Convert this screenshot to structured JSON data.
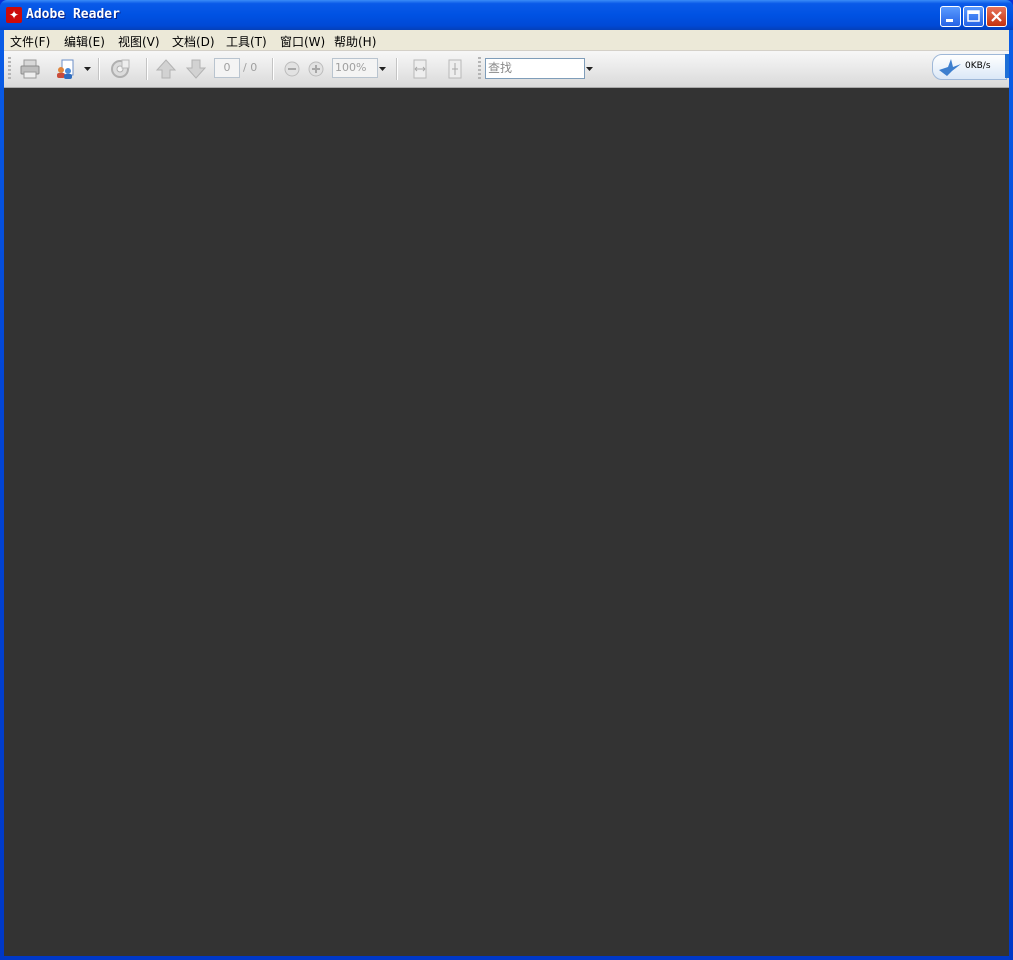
{
  "window": {
    "title": "Adobe Reader",
    "app_icon": "adobe-pdf-icon"
  },
  "caption_buttons": {
    "minimize": "minimize-icon",
    "maximize": "maximize-icon",
    "close": "close-icon"
  },
  "menu": {
    "items": [
      {
        "label": "文件(F)"
      },
      {
        "label": "编辑(E)"
      },
      {
        "label": "视图(V)"
      },
      {
        "label": "文档(D)"
      },
      {
        "label": "工具(T)"
      },
      {
        "label": "窗口(W)"
      },
      {
        "label": "帮助(H)"
      }
    ]
  },
  "toolbar": {
    "page_current": "0",
    "page_total": "/ 0",
    "zoom_value": "100%",
    "find_placeholder": "查找"
  },
  "speed_widget": {
    "value": "0KB/s",
    "icon": "bird-icon"
  },
  "colors": {
    "titlebar": "#0052e3",
    "document_bg": "#333333",
    "toolbar_bg": "#e6e6e6"
  }
}
